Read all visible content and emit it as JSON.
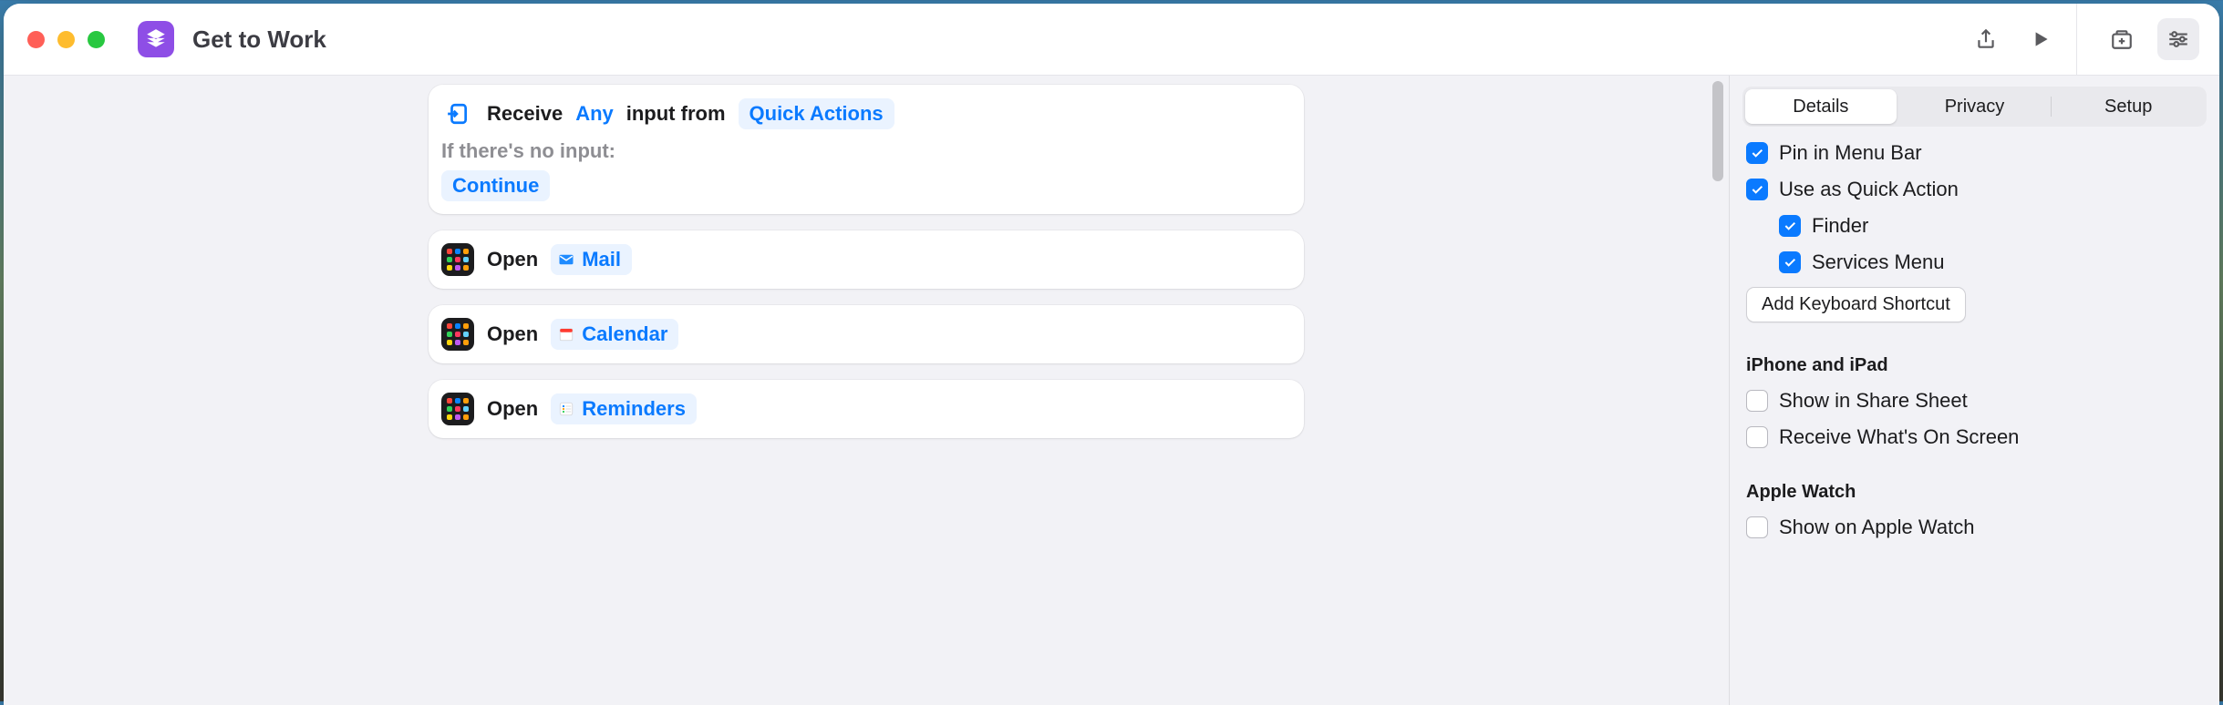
{
  "toolbar": {
    "title": "Get to Work"
  },
  "actions": {
    "receive": {
      "receive_label": "Receive",
      "any_label": "Any",
      "input_from_label": "input from",
      "source_label": "Quick Actions",
      "no_input_label": "If there's no input:",
      "fallback_label": "Continue"
    },
    "open": [
      {
        "verb": "Open",
        "app": "Mail"
      },
      {
        "verb": "Open",
        "app": "Calendar"
      },
      {
        "verb": "Open",
        "app": "Reminders"
      }
    ]
  },
  "sidebar": {
    "tabs": [
      "Details",
      "Privacy",
      "Setup"
    ],
    "active_tab": 0,
    "pin_menu_bar": "Pin in Menu Bar",
    "quick_action": "Use as Quick Action",
    "finder": "Finder",
    "services_menu": "Services Menu",
    "add_shortcut_btn": "Add Keyboard Shortcut",
    "section_ios": "iPhone and iPad",
    "share_sheet": "Show in Share Sheet",
    "receive_screen": "Receive What's On Screen",
    "section_watch": "Apple Watch",
    "show_watch": "Show on Apple Watch"
  }
}
